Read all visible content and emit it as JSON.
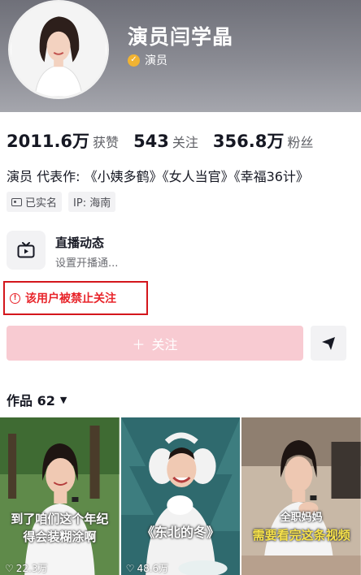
{
  "profile": {
    "name": "演员闫学晶",
    "verification": "演员"
  },
  "stats": [
    {
      "value": "2011.6万",
      "label": "获赞"
    },
    {
      "value": "543",
      "label": "关注"
    },
    {
      "value": "356.8万",
      "label": "粉丝"
    }
  ],
  "bio": "演员 代表作: 《小姨多鹤》《女人当官》《幸福36计》",
  "tags": {
    "realname": "已实名",
    "ip": "IP: 海南"
  },
  "live": {
    "title": "直播动态",
    "subtitle": "设置开播通..."
  },
  "notice": {
    "banned_text": "该用户被禁止关注"
  },
  "follow_button": {
    "label": "关注"
  },
  "works": {
    "label": "作品 62",
    "items": [
      {
        "caption": "到了咱们这个年纪",
        "caption2": "得会装糊涂啊",
        "plays": "22.3万"
      },
      {
        "caption": "《东北的冬》",
        "plays": "48.6万"
      },
      {
        "caption": "全职妈妈",
        "caption2": "需要看完这条视频",
        "plays": ""
      }
    ]
  },
  "colors": {
    "accent_pink": "#f8cbd2",
    "ban_red": "#e8242a",
    "verify_gold": "#f1b332"
  }
}
